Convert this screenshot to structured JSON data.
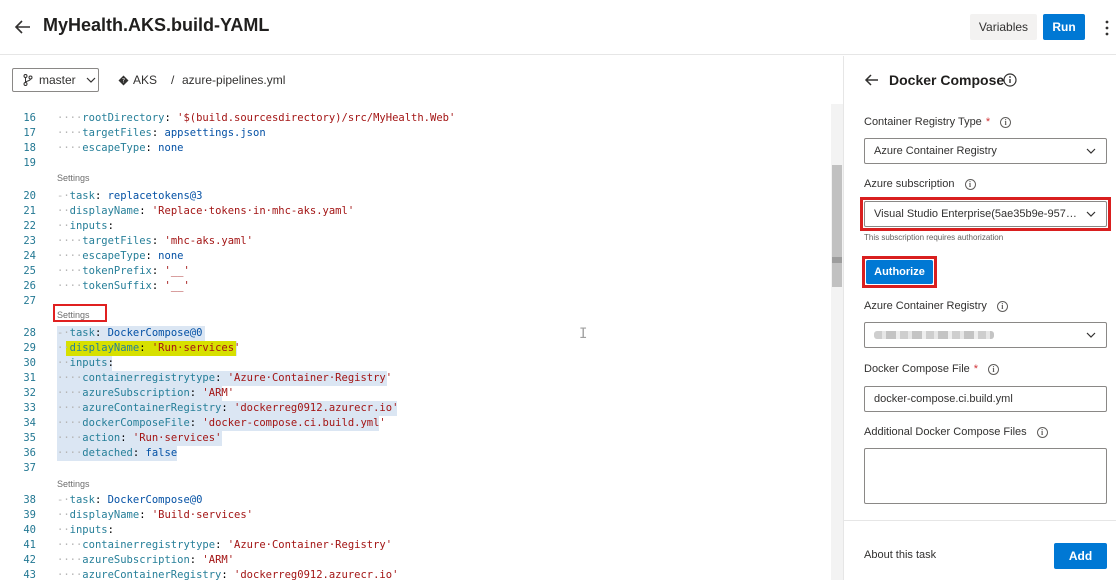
{
  "header": {
    "title": "MyHealth.AKS.build-YAML",
    "variables_label": "Variables",
    "run_label": "Run"
  },
  "toolbar": {
    "branch": "master",
    "repo": "AKS",
    "path_separator": "/",
    "file": "azure-pipelines.yml"
  },
  "editor": {
    "codelens_label": "Settings",
    "lines": [
      {
        "n": "16",
        "indent": "····",
        "key": "rootDirectory",
        "sep": ": ",
        "val": "'$(build.sourcesdirectory)/src/MyHealth.Web'",
        "vtype": "s"
      },
      {
        "n": "17",
        "indent": "····",
        "key": "targetFiles",
        "sep": ": ",
        "val": "appsettings.json",
        "vtype": "v"
      },
      {
        "n": "18",
        "indent": "····",
        "key": "escapeType",
        "sep": ": ",
        "val": "none",
        "vtype": "v"
      },
      {
        "n": "19",
        "indent": "",
        "key": "",
        "sep": "",
        "val": "",
        "vtype": "v"
      },
      {
        "n": "20",
        "indent": "-·",
        "key": "task",
        "sep": ": ",
        "val": "replacetokens@3",
        "vtype": "v"
      },
      {
        "n": "21",
        "indent": "··",
        "key": "displayName",
        "sep": ": ",
        "val": "'Replace·tokens·in·mhc-aks.yaml'",
        "vtype": "s"
      },
      {
        "n": "22",
        "indent": "··",
        "key": "inputs",
        "sep": ":",
        "val": "",
        "vtype": "v"
      },
      {
        "n": "23",
        "indent": "····",
        "key": "targetFiles",
        "sep": ": ",
        "val": "'mhc-aks.yaml'",
        "vtype": "s"
      },
      {
        "n": "24",
        "indent": "····",
        "key": "escapeType",
        "sep": ": ",
        "val": "none",
        "vtype": "v"
      },
      {
        "n": "25",
        "indent": "····",
        "key": "tokenPrefix",
        "sep": ": ",
        "val": "'__'",
        "vtype": "s"
      },
      {
        "n": "26",
        "indent": "····",
        "key": "tokenSuffix",
        "sep": ": ",
        "val": "'__'",
        "vtype": "s"
      },
      {
        "n": "27",
        "indent": "",
        "key": "",
        "sep": "",
        "val": "",
        "vtype": "v"
      },
      {
        "n": "28",
        "indent": "-·",
        "key": "task",
        "sep": ": ",
        "val": "DockerCompose@0",
        "vtype": "v"
      },
      {
        "n": "29",
        "indent": "··",
        "key": "displayName",
        "sep": ": ",
        "val": "'Run·services'",
        "vtype": "s"
      },
      {
        "n": "30",
        "indent": "··",
        "key": "inputs",
        "sep": ":",
        "val": "",
        "vtype": "v"
      },
      {
        "n": "31",
        "indent": "····",
        "key": "containerregistrytype",
        "sep": ": ",
        "val": "'Azure·Container·Registry'",
        "vtype": "s"
      },
      {
        "n": "32",
        "indent": "····",
        "key": "azureSubscription",
        "sep": ": ",
        "val": "'ARM'",
        "vtype": "s"
      },
      {
        "n": "33",
        "indent": "····",
        "key": "azureContainerRegistry",
        "sep": ": ",
        "val": "'dockerreg0912.azurecr.io'",
        "vtype": "s"
      },
      {
        "n": "34",
        "indent": "····",
        "key": "dockerComposeFile",
        "sep": ": ",
        "val": "'docker-compose.ci.build.yml'",
        "vtype": "s"
      },
      {
        "n": "35",
        "indent": "····",
        "key": "action",
        "sep": ": ",
        "val": "'Run·services'",
        "vtype": "s"
      },
      {
        "n": "36",
        "indent": "····",
        "key": "detached",
        "sep": ": ",
        "val": "false",
        "vtype": "v"
      },
      {
        "n": "37",
        "indent": "",
        "key": "",
        "sep": "",
        "val": "",
        "vtype": "v"
      },
      {
        "n": "38",
        "indent": "-·",
        "key": "task",
        "sep": ": ",
        "val": "DockerCompose@0",
        "vtype": "v"
      },
      {
        "n": "39",
        "indent": "··",
        "key": "displayName",
        "sep": ": ",
        "val": "'Build·services'",
        "vtype": "s"
      },
      {
        "n": "40",
        "indent": "··",
        "key": "inputs",
        "sep": ":",
        "val": "",
        "vtype": "v"
      },
      {
        "n": "41",
        "indent": "····",
        "key": "containerregistrytype",
        "sep": ": ",
        "val": "'Azure·Container·Registry'",
        "vtype": "s"
      },
      {
        "n": "42",
        "indent": "····",
        "key": "azureSubscription",
        "sep": ": ",
        "val": "'ARM'",
        "vtype": "s"
      },
      {
        "n": "43",
        "indent": "····",
        "key": "azureContainerRegistry",
        "sep": ": ",
        "val": "'dockerreg0912.azurecr.io'",
        "vtype": "s"
      }
    ]
  },
  "panel": {
    "title": "Docker Compose",
    "registry_type_label": "Container Registry Type",
    "registry_type_value": "Azure Container Registry",
    "subscription_label": "Azure subscription",
    "subscription_value": "Visual Studio Enterprise(5ae35b9e-9571...",
    "subscription_hint": "This subscription requires authorization",
    "authorize_label": "Authorize",
    "acr_label": "Azure Container Registry",
    "compose_file_label": "Docker Compose File",
    "compose_file_value": "docker-compose.ci.build.yml",
    "additional_files_label": "Additional Docker Compose Files",
    "required_mark": "*",
    "about_label": "About this task",
    "add_label": "Add"
  }
}
